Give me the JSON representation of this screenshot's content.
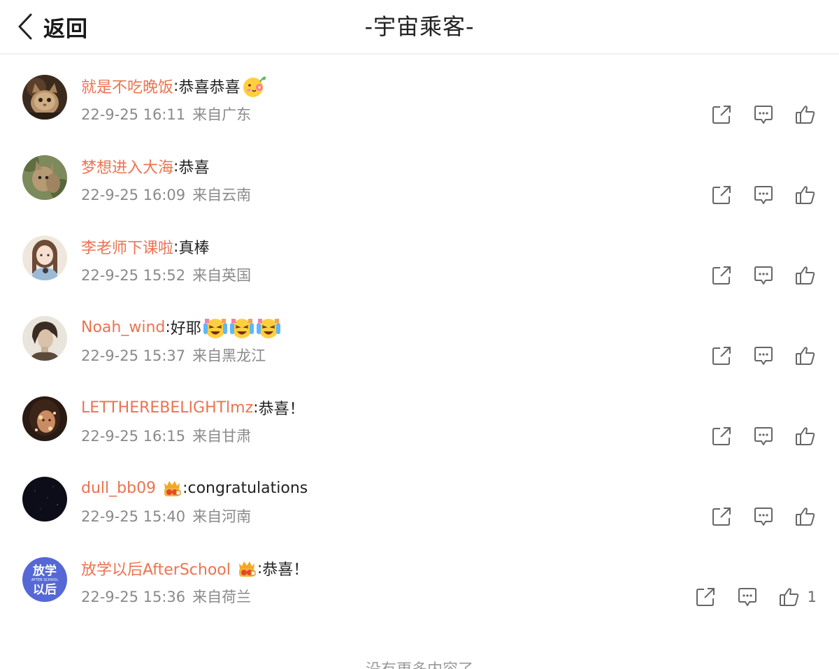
{
  "header": {
    "back_label": "返回",
    "title": "-宇宙乘客-"
  },
  "colors": {
    "username": "#eb7350",
    "meta": "#8a8a8a",
    "icon": "#666666"
  },
  "comments": [
    {
      "username": "就是不吃晚饭",
      "text": "恭喜恭喜",
      "emojis": [
        "flower-smile-emoji"
      ],
      "badge": false,
      "time": "22-9-25 16:11",
      "location": "来自广东",
      "likes": ""
    },
    {
      "username": "梦想进入大海",
      "text": "恭喜",
      "emojis": [],
      "badge": false,
      "time": "22-9-25 16:09",
      "location": "来自云南",
      "likes": ""
    },
    {
      "username": "李老师下课啦",
      "text": "真棒",
      "emojis": [],
      "badge": false,
      "time": "22-9-25 15:52",
      "location": "来自英国",
      "likes": ""
    },
    {
      "username": "Noah_wind",
      "text": "好耶",
      "emojis": [
        "tears-joy-emoji",
        "tears-joy-emoji",
        "tears-joy-emoji"
      ],
      "badge": false,
      "time": "22-9-25 15:37",
      "location": "来自黑龙江",
      "likes": ""
    },
    {
      "username": "LETTHEREBELIGHTlmz",
      "text": "恭喜！",
      "emojis": [],
      "badge": false,
      "time": "22-9-25 16:15",
      "location": "来自甘肃",
      "likes": ""
    },
    {
      "username": "dull_bb09",
      "text": "congratulations",
      "emojis": [],
      "badge": true,
      "time": "22-9-25 15:40",
      "location": "来自河南",
      "likes": ""
    },
    {
      "username": "放学以后AfterSchool",
      "text": "恭喜！",
      "emojis": [],
      "badge": true,
      "time": "22-9-25 15:36",
      "location": "来自荷兰",
      "likes": "1",
      "avatar_text_top": "放学",
      "avatar_text_small": "AFTER SCHOOL",
      "avatar_text_bottom": "以后"
    }
  ],
  "footer": {
    "no_more": "没有更多内容了"
  }
}
